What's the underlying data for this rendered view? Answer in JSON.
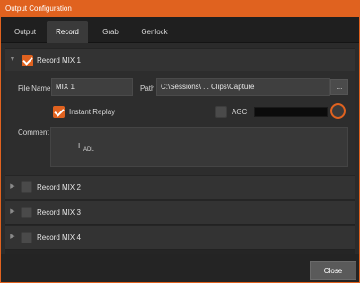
{
  "window": {
    "title": "Output Configuration"
  },
  "tabs": [
    {
      "label": "Output",
      "active": false
    },
    {
      "label": "Record",
      "active": true
    },
    {
      "label": "Grab",
      "active": false
    },
    {
      "label": "Genlock",
      "active": false
    }
  ],
  "record_mix_1": {
    "label": "Record MIX 1",
    "enabled": true,
    "expanded": true,
    "file_name_label": "File Name",
    "file_name_value": "MIX 1",
    "path_label": "Path",
    "path_value": "C:\\Sessions\\ ... Clips\\Capture",
    "browse_label": "...",
    "instant_replay_label": "Instant Replay",
    "instant_replay_checked": true,
    "agc_label": "AGC",
    "agc_checked": false,
    "comment_label": "Comment",
    "comment_cursor_text": "I",
    "comment_overlay_text": "ADL"
  },
  "collapsed_sections": [
    {
      "label": "Record MIX 2",
      "enabled": false
    },
    {
      "label": "Record MIX 3",
      "enabled": false
    },
    {
      "label": "Record MIX 4",
      "enabled": false
    }
  ],
  "footer": {
    "close_label": "Close"
  },
  "colors": {
    "accent": "#e0621f",
    "background": "#2b2b2b",
    "tabbar": "#1f1f1f"
  },
  "icons": {
    "expander_expanded": "chevron-down-icon",
    "expander_collapsed": "chevron-right-icon"
  }
}
